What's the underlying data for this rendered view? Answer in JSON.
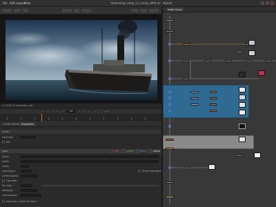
{
  "window": {
    "title": "steamship_comp_v1_comp_v004.nk - NukeX",
    "menus": [
      "File",
      "Edit",
      "Layout",
      "Help"
    ]
  },
  "viewer": {
    "info_text": "x=1106 Y0 channels: rgb",
    "frame": "14"
  },
  "properties": {
    "tabs": [
      "Script Viewer",
      "Properties"
    ],
    "section_title": "Write1",
    "rows": [
      {
        "label": "channels",
        "value": "rgba"
      },
      {
        "label": "file",
        "value": "output_v001.####.exr"
      },
      {
        "label": "proxy",
        "value": ""
      },
      {
        "label": "frame",
        "value": "10"
      },
      {
        "label": "views",
        "value": "main"
      },
      {
        "label": "colorspace",
        "value": "linear"
      },
      {
        "label": "premultiplied",
        "value": ""
      },
      {
        "label": "raw data",
        "value": ""
      },
      {
        "label": "file type",
        "value": "exr"
      },
      {
        "label": "datatype",
        "value": "16 bit half"
      },
      {
        "label": "compression",
        "value": "Zip (1 scanline)"
      }
    ],
    "channels": [
      "red",
      "green",
      "blue",
      "alpha"
    ],
    "checkbox_label": "Show metadata",
    "footer_label": "autocrop / write full layer"
  },
  "graph": {
    "tab_label": "Node Graph"
  },
  "colors": {
    "accent": "#e06a1e",
    "backdrop_blue": "#2f6a92",
    "backdrop_gray": "#8a8a8a",
    "node_blue": "#5b6fc8"
  }
}
